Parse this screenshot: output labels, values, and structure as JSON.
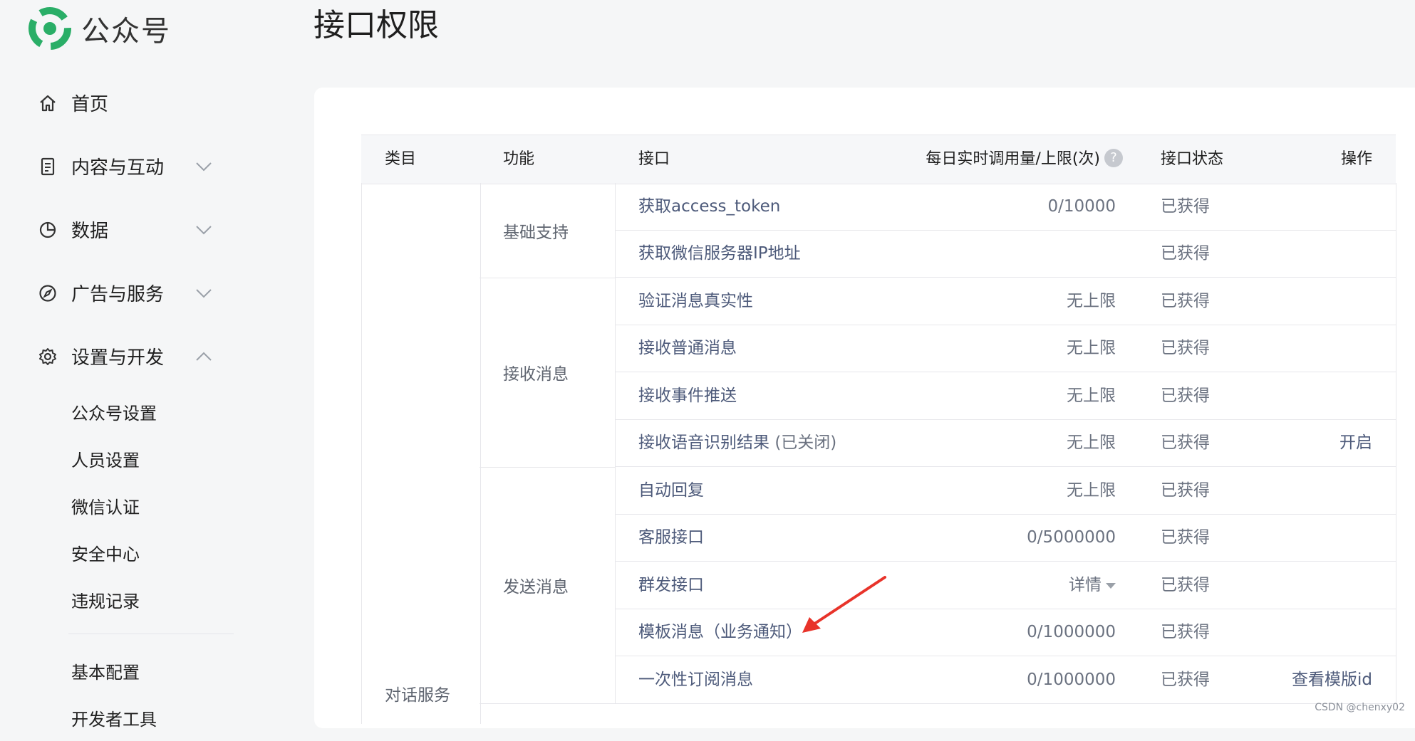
{
  "app": {
    "name": "公众号",
    "brand_color": "#2aae67"
  },
  "sidebar": {
    "items": [
      {
        "label": "首页",
        "icon": "home-icon"
      },
      {
        "label": "内容与互动",
        "icon": "document-icon",
        "expanded": false
      },
      {
        "label": "数据",
        "icon": "pie-chart-icon",
        "expanded": false
      },
      {
        "label": "广告与服务",
        "icon": "compass-icon",
        "expanded": false
      },
      {
        "label": "设置与开发",
        "icon": "gear-icon",
        "expanded": true
      }
    ],
    "settings_sub": [
      "公众号设置",
      "人员设置",
      "微信认证",
      "安全中心",
      "违规记录"
    ],
    "dev_sub": [
      "基本配置",
      "开发者工具"
    ]
  },
  "page": {
    "title": "接口权限"
  },
  "table": {
    "headers": {
      "category": "类目",
      "function": "功能",
      "api": "接口",
      "usage": "每日实时调用量/上限(次)",
      "status": "接口状态",
      "operation": "操作"
    },
    "category": "对话服务",
    "groups": [
      {
        "name": "基础支持"
      },
      {
        "name": "接收消息"
      },
      {
        "name": "发送消息"
      }
    ],
    "rows": [
      {
        "api": "获取access_token",
        "usage": "0/10000",
        "status": "已获得",
        "op": ""
      },
      {
        "api": "获取微信服务器IP地址",
        "usage": "",
        "status": "已获得",
        "op": ""
      },
      {
        "api": "验证消息真实性",
        "usage": "无上限",
        "status": "已获得",
        "op": ""
      },
      {
        "api": "接收普通消息",
        "usage": "无上限",
        "status": "已获得",
        "op": ""
      },
      {
        "api": "接收事件推送",
        "usage": "无上限",
        "status": "已获得",
        "op": ""
      },
      {
        "api": "接收语音识别结果",
        "api_note": "(已关闭)",
        "usage": "无上限",
        "status": "已获得",
        "op": "开启"
      },
      {
        "api": "自动回复",
        "usage": "无上限",
        "status": "已获得",
        "op": ""
      },
      {
        "api": "客服接口",
        "usage": "0/5000000",
        "status": "已获得",
        "op": ""
      },
      {
        "api": "群发接口",
        "usage": "详情",
        "status": "已获得",
        "op": ""
      },
      {
        "api": "模板消息（业务通知）",
        "usage": "0/1000000",
        "status": "已获得",
        "op": ""
      },
      {
        "api": "一次性订阅消息",
        "usage": "0/1000000",
        "status": "已获得",
        "op": "查看模版id"
      }
    ]
  },
  "annotation": {
    "arrow_color": "#e8332a"
  },
  "watermark": "CSDN @chenxy02"
}
